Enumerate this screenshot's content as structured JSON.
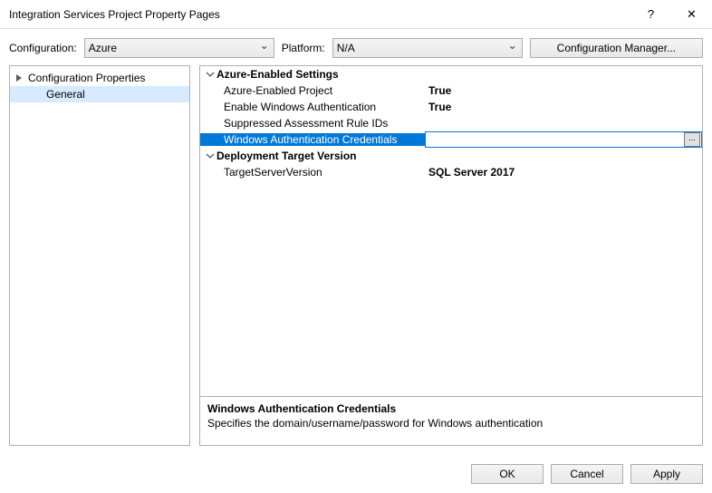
{
  "title": "Integration Services Project Property Pages",
  "config_label": "Configuration:",
  "config_value": "Azure",
  "platform_label": "Platform:",
  "platform_value": "N/A",
  "config_mgr": "Configuration Manager...",
  "tree": {
    "root": "Configuration Properties",
    "child": "General"
  },
  "categories": [
    {
      "label": "Azure-Enabled Settings"
    },
    {
      "label": "Deployment Target Version"
    }
  ],
  "props": {
    "azure_enabled": {
      "name": "Azure-Enabled Project",
      "value": "True"
    },
    "win_auth": {
      "name": "Enable Windows Authentication",
      "value": "True"
    },
    "suppressed": {
      "name": "Suppressed Assessment Rule IDs",
      "value": ""
    },
    "credentials": {
      "name": "Windows Authentication Credentials",
      "value": ""
    },
    "target_server": {
      "name": "TargetServerVersion",
      "value": "SQL Server 2017"
    }
  },
  "ellipsis": "...",
  "desc": {
    "title": "Windows Authentication Credentials",
    "text": "Specifies the domain/username/password for Windows authentication"
  },
  "buttons": {
    "ok": "OK",
    "cancel": "Cancel",
    "apply": "Apply"
  }
}
